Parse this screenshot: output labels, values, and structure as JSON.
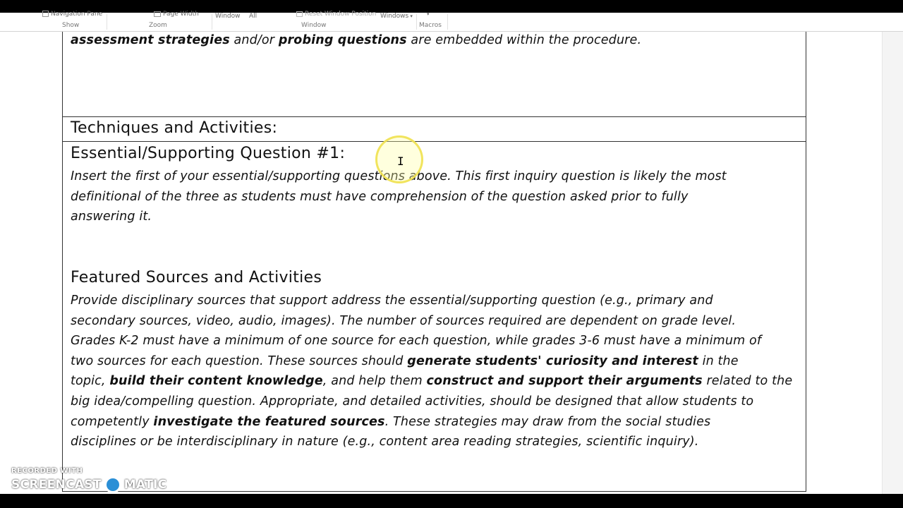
{
  "ribbon": {
    "navigation_pane": "Navigation Pane",
    "page_width": "Page Width",
    "window_btn": "Window",
    "all_btn": "All",
    "reset_window_position": "Reset Window Position",
    "windows_btn": "Windows",
    "groups": {
      "show": "Show",
      "zoom": "Zoom",
      "window": "Window",
      "macros": "Macros"
    }
  },
  "document": {
    "top_line": {
      "bold1": "assessment strategies",
      "text1": " and/or ",
      "bold2": "probing questions",
      "text2": " are embedded within the procedure."
    },
    "techniques_heading": "Techniques and Activities:",
    "essential_heading": "Essential/Supporting Question #1:",
    "essential_lines": [
      "Insert the first of your essential/supporting questions above. This first inquiry question is likely the most",
      "definitional of the three as students must have comprehension of the question asked prior to fully",
      "answering it."
    ],
    "featured_heading": "Featured Sources and Activities",
    "featured": {
      "l1": "Provide disciplinary sources that support address the essential/supporting question (e.g., primary and",
      "l2": "secondary sources, video, audio, images). The number of sources required are dependent on grade level.",
      "l3": "Grades K-2 must have a minimum of one source for each question, while grades 3-6 must have a minimum of",
      "l4a": "two sources for each question. These sources should ",
      "l4b": "generate students' curiosity and interest",
      "l4c": " in the",
      "l5a": "topic, ",
      "l5b": "build their content knowledge",
      "l5c": ", and help them ",
      "l5d": "construct and support their arguments",
      "l5e": " related to the",
      "l6": "big idea/compelling question. Appropriate, and detailed activities, should be designed that allow students to",
      "l7a": "competently ",
      "l7b": "investigate the featured sources",
      "l7c": ". These strategies may draw from the social studies",
      "l8": "disciplines or be interdisciplinary in nature (e.g., content area reading strategies, scientific inquiry)."
    }
  },
  "watermark": {
    "top": "RECORDED WITH",
    "left": "SCREENCAST",
    "right": "MATIC"
  }
}
